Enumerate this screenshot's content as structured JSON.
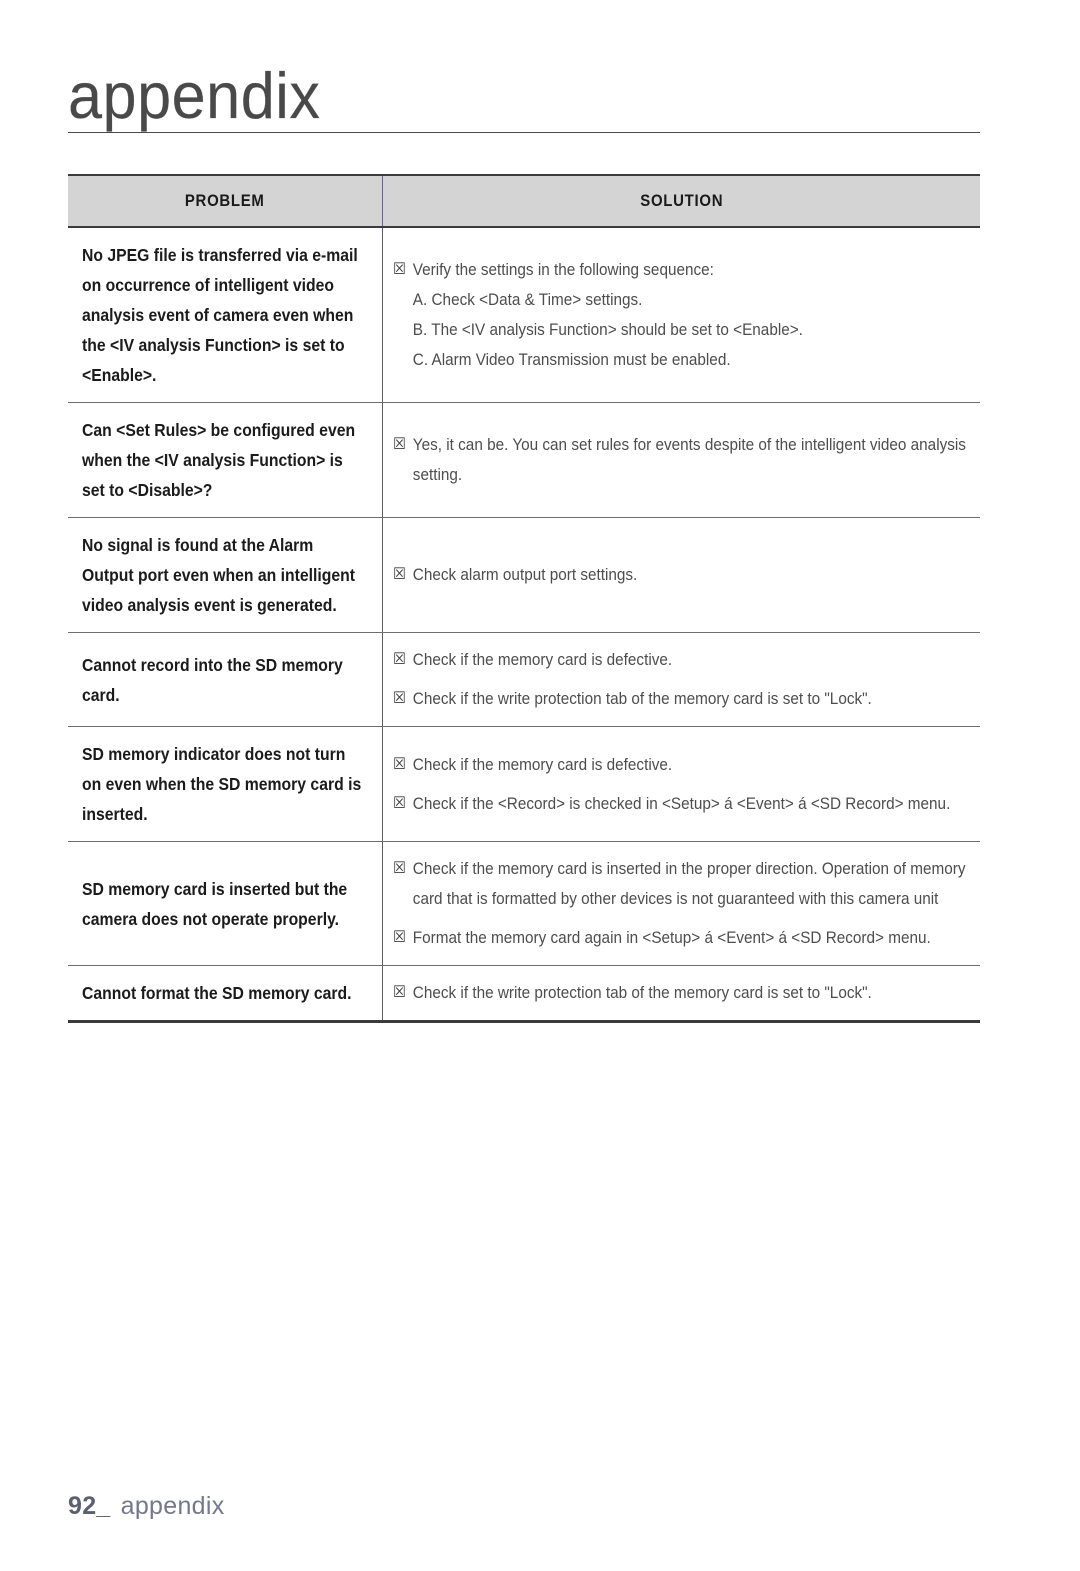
{
  "header": {
    "title": "appendix"
  },
  "table": {
    "columns": [
      "PROBLEM",
      "SOLUTION"
    ],
    "bullet": "☒",
    "rows": [
      {
        "problem": "No JPEG file is transferred via e-mail on occurrence of intelligent video analysis event of camera even when the <IV analysis Function> is set to <Enable>.",
        "solution": [
          {
            "type": "bullet",
            "text": "Verify the settings in the following sequence:"
          },
          {
            "type": "indent",
            "text": "A. Check <Data & Time> settings."
          },
          {
            "type": "indent",
            "text": "B. The <IV analysis Function> should be set to <Enable>."
          },
          {
            "type": "indent",
            "text": "C. Alarm Video Transmission must be enabled."
          }
        ]
      },
      {
        "problem": "Can <Set Rules> be configured even when the <IV analysis Function> is set to <Disable>?",
        "solution": [
          {
            "type": "bullet",
            "text": "Yes, it can be. You can set rules for events despite of the intelligent video analysis setting."
          }
        ]
      },
      {
        "problem": "No signal is found at the Alarm Output port even when an intelligent video analysis event is generated.",
        "solution": [
          {
            "type": "bullet",
            "text": "Check alarm output port settings."
          }
        ]
      },
      {
        "problem": "Cannot record into the SD memory card.",
        "solution": [
          {
            "type": "bullet",
            "text": "Check if the memory card is defective."
          },
          {
            "type": "bullet",
            "text": "Check if the write protection tab of the memory card is set to \"Lock\"."
          }
        ]
      },
      {
        "problem": "SD memory indicator does not turn on even when the SD memory card is inserted.",
        "solution": [
          {
            "type": "bullet",
            "text": "Check if the memory card is defective."
          },
          {
            "type": "bullet",
            "text": "Check if the <Record> is checked in <Setup> á  <Event> á  <SD Record> menu."
          }
        ]
      },
      {
        "problem": "SD memory card is inserted but the camera does not operate properly.",
        "solution": [
          {
            "type": "bullet",
            "text": "Check if the memory card is inserted in the proper direction. Operation of memory card that is formatted by other devices is not guaranteed with this camera unit"
          },
          {
            "type": "bullet",
            "text": "Format the memory card again in <Setup> á  <Event> á  <SD Record> menu."
          }
        ]
      },
      {
        "problem": "Cannot format the SD memory card.",
        "solution": [
          {
            "type": "bullet",
            "text": "Check if the write protection tab of the memory card is set to \"Lock\"."
          }
        ]
      }
    ]
  },
  "footer": {
    "page_number": "92_",
    "section": "appendix"
  },
  "colors": {
    "header_row_bg": "#d4d4d4",
    "rule": "#3b3b3b",
    "problem_text": "#1b1b1b",
    "solution_text": "#4d4d4d",
    "footer_text": "#6e7288"
  }
}
